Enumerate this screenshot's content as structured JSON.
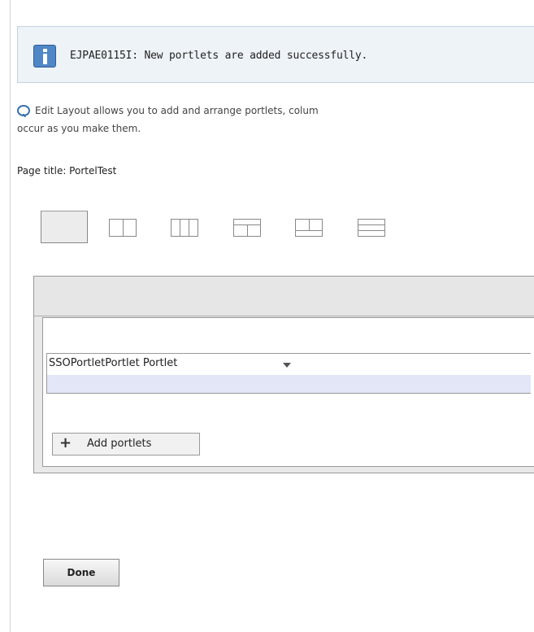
{
  "message": {
    "icon": "info-icon",
    "text": "EJPAE0115I: New portlets are added successfully."
  },
  "help": {
    "icon": "speech-bubble-icon",
    "line1": "Edit Layout allows you to add and arrange portlets, colum",
    "line2": "occur as you make them."
  },
  "page": {
    "title_label": "Page title: PortelTest"
  },
  "layout_options": [
    {
      "name": "one-column",
      "selected": true
    },
    {
      "name": "two-columns",
      "selected": false
    },
    {
      "name": "three-columns",
      "selected": false
    },
    {
      "name": "header-two-columns",
      "selected": false
    },
    {
      "name": "two-columns-footer",
      "selected": false
    },
    {
      "name": "header-one-column",
      "selected": false
    }
  ],
  "portlet": {
    "title": "SSOPortletPortlet Portlet",
    "menu_icon": "chevron-down-icon"
  },
  "add_portlets": {
    "icon": "plus-icon",
    "label": "Add portlets"
  },
  "done": {
    "label": "Done"
  },
  "colors": {
    "message_bg": "#eef3f8",
    "info_blue": "#4f86c6",
    "portlet_body": "#e2e6f7"
  }
}
